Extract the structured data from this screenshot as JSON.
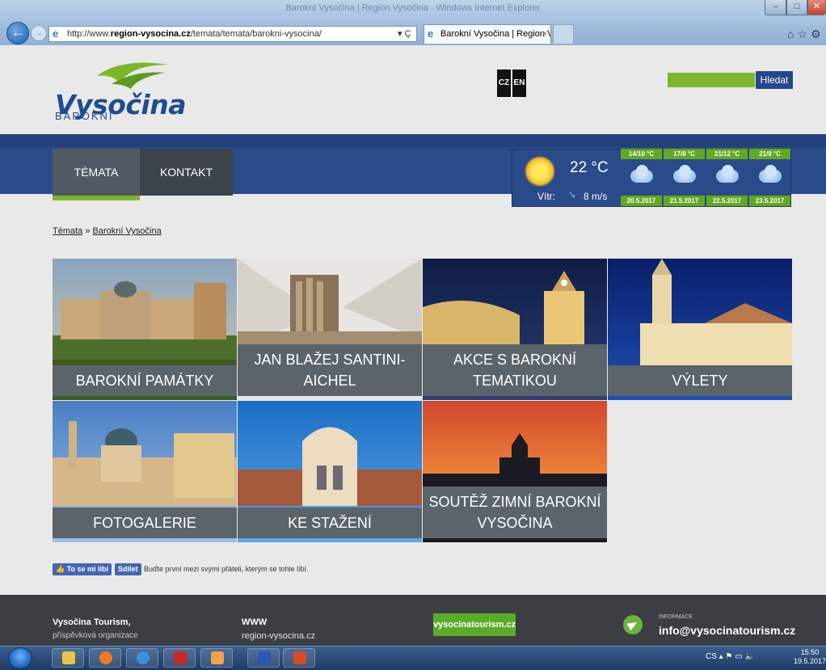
{
  "browser": {
    "title": "Barokní Vysočina | Region Vysočina - Windows Internet Explorer",
    "url_prefix": "http://www.",
    "url_domain": "region-vysocina.cz",
    "url_path": "/temata/temata/barokni-vysocina/",
    "tab_title": "Barokní Vysočina | Region V...",
    "tab_close": "×",
    "addr_tools": "▾ Ç",
    "back_glyph": "←",
    "fwd_glyph": "→",
    "win_min": "–",
    "win_max": "□",
    "win_close": "✕",
    "chrome_icons": "⌂☆⚙"
  },
  "header": {
    "logo_text": "Vysočina",
    "logo_sub": "BAROKNÍ",
    "lang_cz": "CZ",
    "lang_en": "EN",
    "search_button": "Hledat"
  },
  "nav": {
    "items": [
      {
        "label": "TÉMATA"
      },
      {
        "label": "KONTAKT"
      }
    ]
  },
  "weather": {
    "temp": "22 °C",
    "wind_label": "Vítr:",
    "wind_value": "8 m/s",
    "forecast": [
      {
        "temp": "14/10 °C",
        "date": "20.5.2017"
      },
      {
        "temp": "17/8 °C",
        "date": "21.5.2017"
      },
      {
        "temp": "21/12 °C",
        "date": "22.5.2017"
      },
      {
        "temp": "21/9 °C",
        "date": "23.5.2017"
      }
    ]
  },
  "breadcrumb": {
    "root": "Témata",
    "separator": " » ",
    "current": "Barokní Vysočina"
  },
  "tiles": [
    {
      "label": "BAROKNÍ PAMÁTKY"
    },
    {
      "label": "JAN BLAŽEJ SANTINI-AICHEL"
    },
    {
      "label": "AKCE S BAROKNÍ TEMATIKOU"
    },
    {
      "label": "VÝLETY"
    },
    {
      "label": "FOTOGALERIE"
    },
    {
      "label": "KE STAŽENÍ"
    },
    {
      "label": "SOUTĚŽ ZIMNÍ BAROKNÍ VYSOČINA"
    }
  ],
  "social": {
    "like": "To se mi líbí",
    "share": "Sdílet",
    "text": "Buďte první mezi svými přáteli, kterým se tohle líbí."
  },
  "footer": {
    "org": "Vysočina Tourism,",
    "org_sub": "příspěvková organizace",
    "www_label": "WWW",
    "www_value": "region-vysocina.cz",
    "button": "vysocinatourism.cz",
    "info_label": "INFORMACE",
    "info_email": "info@vysocinatourism.cz"
  },
  "taskbar": {
    "tray": "CS  ▴  ⚑  ▭  🔈",
    "time": "15:50",
    "date": "19.5.2017"
  }
}
